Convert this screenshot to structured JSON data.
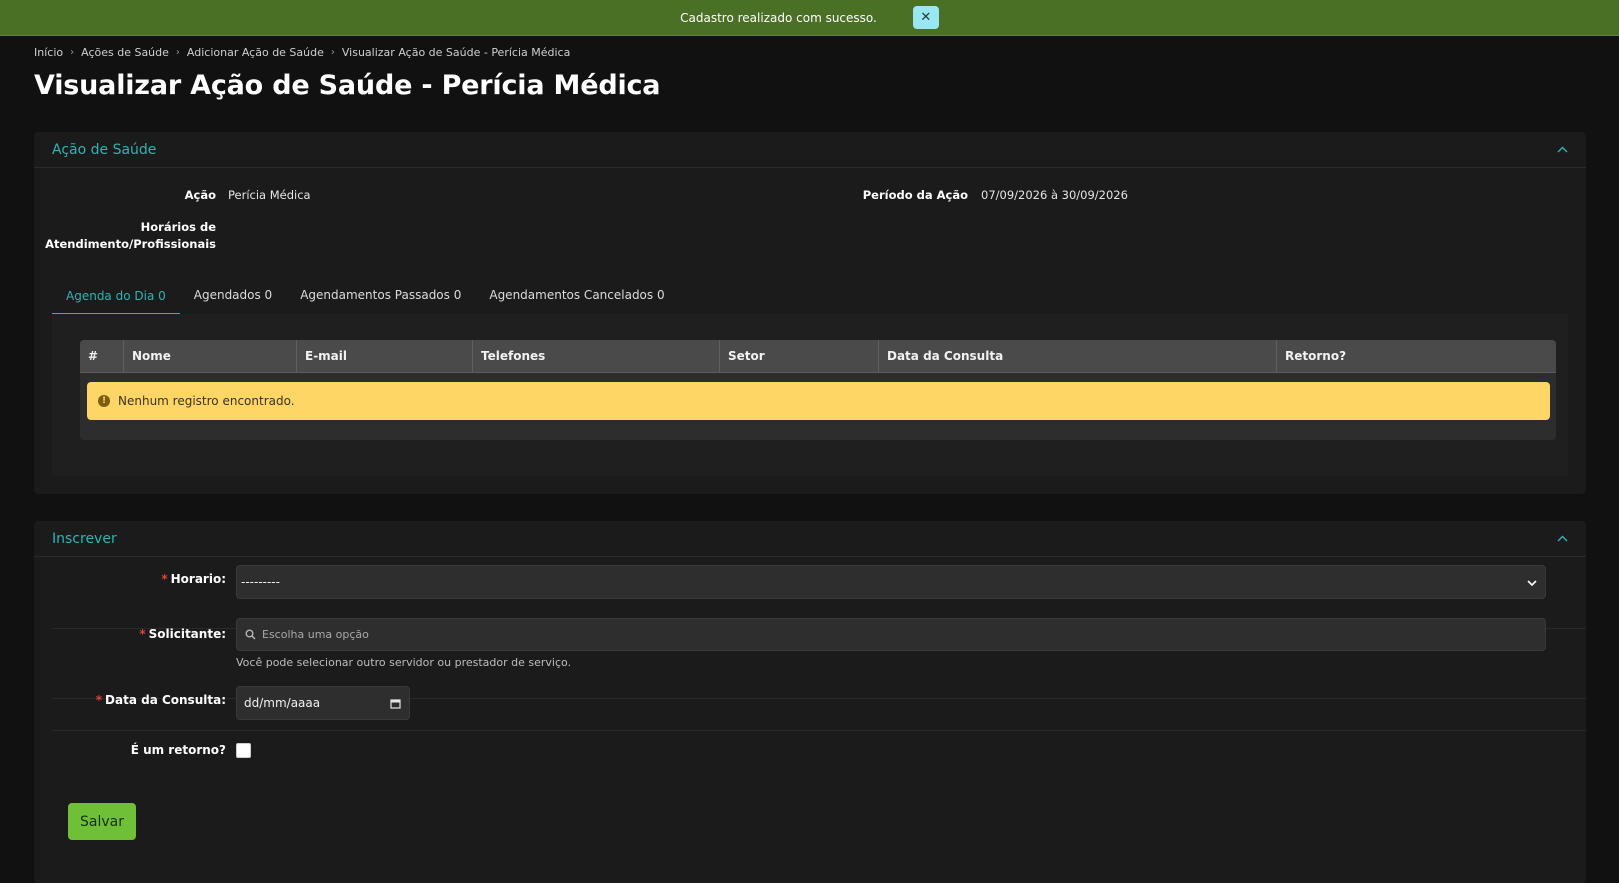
{
  "banner": {
    "message": "Cadastro realizado com sucesso.",
    "close_label": "✕"
  },
  "breadcrumb": [
    "Início",
    "Ações de Saúde",
    "Adicionar Ação de Saúde",
    "Visualizar Ação de Saúde - Perícia Médica"
  ],
  "page_title": "Visualizar Ação de Saúde - Perícia Médica",
  "panel_acao": {
    "title": "Ação de Saúde",
    "acao_label": "Ação",
    "acao_value": "Perícia Médica",
    "periodo_label": "Período da Ação",
    "periodo_value": "07/09/2026 à 30/09/2026",
    "horarios_label_line1": "Horários de",
    "horarios_label_line2": "Atendimento/Profissionais",
    "tabs": [
      {
        "label": "Agenda do Dia 0",
        "active": true
      },
      {
        "label": "Agendados 0",
        "active": false
      },
      {
        "label": "Agendamentos Passados 0",
        "active": false
      },
      {
        "label": "Agendamentos Cancelados 0",
        "active": false
      }
    ],
    "table_columns": [
      "#",
      "Nome",
      "E-mail",
      "Telefones",
      "Setor",
      "Data da Consulta",
      "Retorno?"
    ],
    "empty_message": "Nenhum registro encontrado."
  },
  "panel_inscrever": {
    "title": "Inscrever",
    "required_mark": "*",
    "horario_label": "Horario:",
    "horario_value": "---------",
    "solicitante_label": "Solicitante:",
    "solicitante_placeholder": "Escolha uma opção",
    "solicitante_help": "Você pode selecionar outro servidor ou prestador de serviço.",
    "data_label": "Data da Consulta:",
    "data_placeholder": "dd/mm/aaaa",
    "retorno_label": "É um retorno?",
    "retorno_checked": false,
    "save_label": "Salvar"
  },
  "colors": {
    "banner_bg": "#4a7025",
    "accent": "#2fb3b3",
    "alert_bg": "#fdd665",
    "save_button": "#6fbf37"
  }
}
